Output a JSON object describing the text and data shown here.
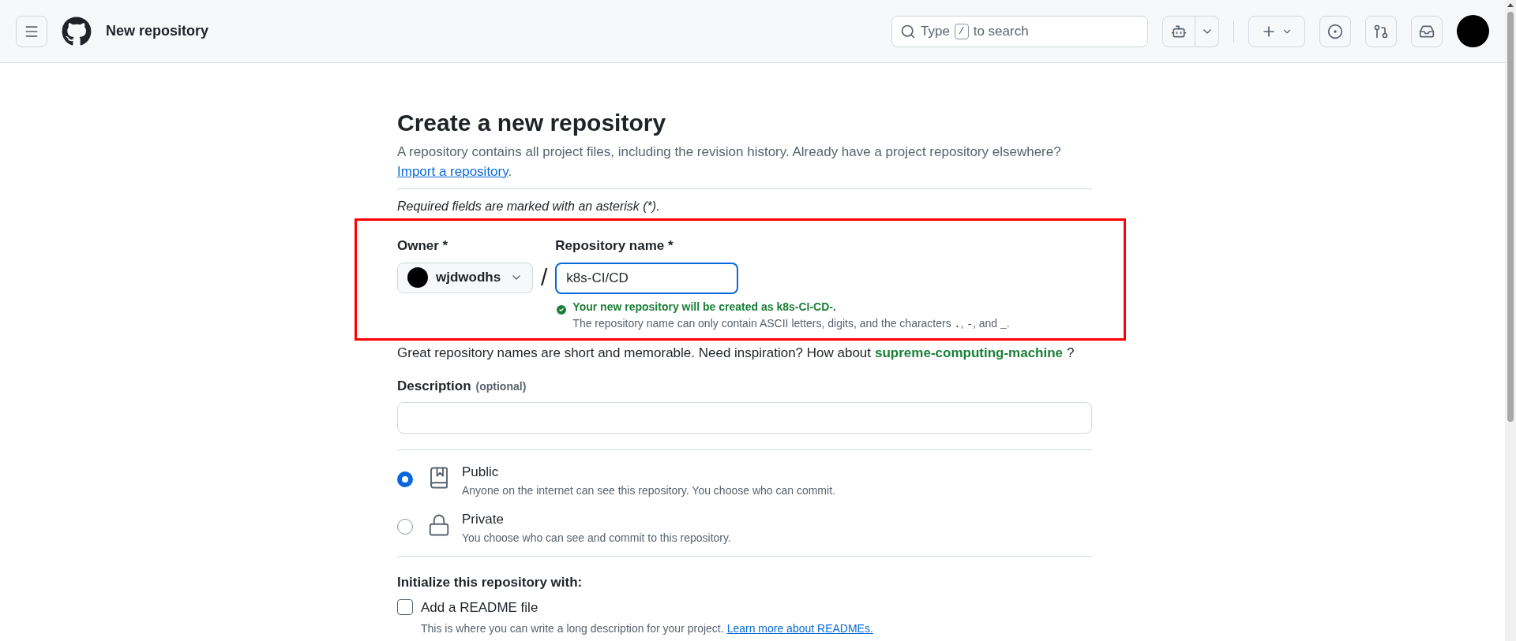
{
  "header": {
    "title": "New repository",
    "search": {
      "before": "Type",
      "key": "/",
      "after": "to search"
    }
  },
  "page": {
    "title": "Create a new repository",
    "intro": "A repository contains all project files, including the revision history. Already have a project repository elsewhere?",
    "import_link": "Import a repository",
    "import_after": ".",
    "required_note": "Required fields are marked with an asterisk (*)."
  },
  "owner": {
    "label": "Owner *",
    "value": "wjdwodhs"
  },
  "separator": "/",
  "repo_name": {
    "label": "Repository name *",
    "value": "k8s-CI/CD",
    "focused": true,
    "valid": true,
    "status": "Your new repository will be created as k8s-CI-CD-.",
    "rule": [
      {
        "kind": "text",
        "text": "The repository name can only contain ASCII letters, digits, and the characters "
      },
      {
        "kind": "code",
        "text": "."
      },
      {
        "kind": "text",
        "text": ", "
      },
      {
        "kind": "code",
        "text": "-"
      },
      {
        "kind": "text",
        "text": ", and "
      },
      {
        "kind": "code",
        "text": "_"
      },
      {
        "kind": "text",
        "text": "."
      }
    ]
  },
  "suggestion": {
    "before": "Great repository names are short and memorable. Need inspiration? How about",
    "name": "supreme-computing-machine",
    "after": "?"
  },
  "description": {
    "label": "Description",
    "hint": "(optional)"
  },
  "visibility": [
    {
      "kind": "public",
      "label": "Public",
      "text": "Anyone on the internet can see this repository. You choose who can commit.",
      "selected": true
    },
    {
      "kind": "private",
      "label": "Private",
      "text": "You choose who can see and commit to this repository.",
      "selected": false
    }
  ],
  "initialize": {
    "title": "Initialize this repository with:",
    "readme": {
      "label": "Add a README file",
      "checked": false,
      "text": "This is where you can write a long description for your project.",
      "link": "Learn more about READMEs."
    }
  }
}
